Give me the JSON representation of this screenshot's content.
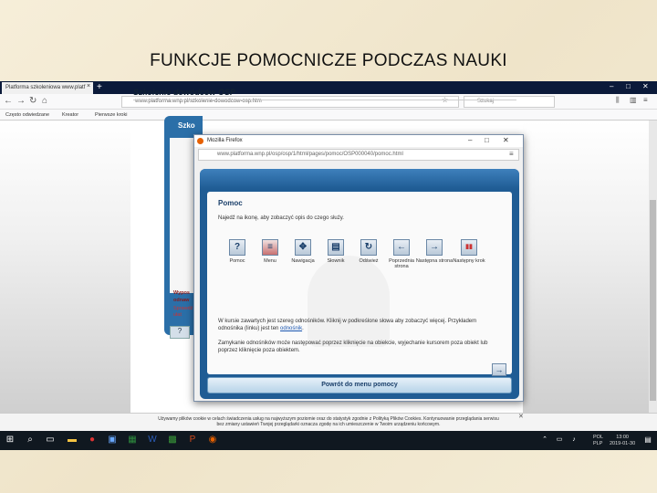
{
  "slide": {
    "title": "FUNKCJE POMOCNICZE PODCZAS NAUKI"
  },
  "browser": {
    "tab_title": "Platforma szkoleniowa www.platf",
    "tab_close": "×",
    "tab_new": "+",
    "window_controls": [
      "–",
      "□",
      "✕"
    ],
    "url": "www.platforma.wnp.pl/szkolenie-dowodcow-osp.htm",
    "search_placeholder": "Szukaj",
    "bookmarks": [
      "Często odwiedzane",
      "Kreator",
      "Pierwsze kroki"
    ]
  },
  "page": {
    "heading": "Szkolenie dowódców OSP",
    "panel_label": "Szko",
    "warn_bold": "Wypos odnaw",
    "warn_red": "Sprawdź i ułat",
    "q_button": "?"
  },
  "cookie": {
    "text_line1": "Używamy plików cookie w celach świadczenia usług na najwyższym poziomie oraz do statystyk zgodnie z Polityką Plików Cookies. Kontynuowanie przeglądania serwisu",
    "text_line2": "bez zmiany ustawień Twojej przeglądarki oznacza zgodę na ich umieszczenie w Twoim urządzeniu końcowym.",
    "close": "✕"
  },
  "taskbar": {
    "tray_lang_1": "POL",
    "tray_lang_2": "PLP",
    "tray_time": "13:00",
    "tray_date": "2019-01-30"
  },
  "popup": {
    "title": "Mozilla Firefox",
    "url": "www.platforma.wnp.pl/osp/osp/1/html/pages/pomoc/OSP000040/pomoc.html",
    "window_controls": [
      "–",
      "□",
      "✕"
    ],
    "menu": "≡",
    "help": {
      "title": "Pomoc",
      "intro": "Najedź na ikonę, aby zobaczyć opis do czego służy.",
      "buttons": [
        {
          "icon": "?",
          "label": "Pomoc"
        },
        {
          "icon": "≡",
          "label": "Menu"
        },
        {
          "icon": "✥",
          "label": "Nawigacja"
        },
        {
          "icon": "▤",
          "label": "Słownik"
        },
        {
          "icon": "↻",
          "label": "Odśwież"
        },
        {
          "icon": "←",
          "label": "Poprzednia strona"
        },
        {
          "icon": "→",
          "label": "Następna strona"
        },
        {
          "icon": "▮▮",
          "label": "Następny krok"
        }
      ],
      "text1_pre": "W kursie zawartych jest szereg odnośników. Kliknij w podkreślone słowa aby zobaczyć więcej. Przykładem odnośnika (linku) jest ten ",
      "text1_link": "odnośnik",
      "text1_post": ".",
      "text2": "Zamykanie odnośników może następować poprzez kliknięcie na obiekcie, wyjechanie kursorem poza obiekt lub poprzez kliknięcie poza obiektem.",
      "next": "→",
      "back_button": "Powrót do menu pomocy"
    }
  },
  "colors": {
    "accent": "#1f5c94",
    "taskbar": "#101820",
    "firefox_orange": "#e66000"
  }
}
